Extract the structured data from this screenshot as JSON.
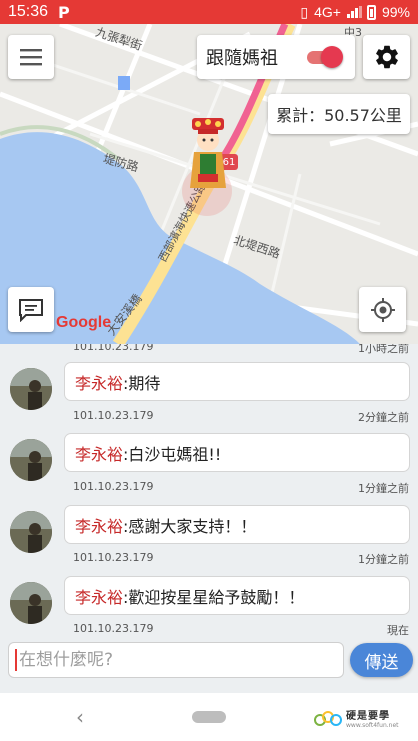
{
  "status_bar": {
    "time": "15:36",
    "app_icon": "P",
    "network": "4G+",
    "battery": "99%",
    "color": "#e53935"
  },
  "map": {
    "follow_label": "跟隨媽祖",
    "follow_enabled": true,
    "distance_text": "累計：50.57公里",
    "roads": [
      "九張犁街",
      "堤防路",
      "西部濱海快速公路",
      "北堤西路",
      "大安溪橋"
    ],
    "route_shield": "61",
    "corner_label": "中3",
    "google_logo": "Google"
  },
  "chat": {
    "top_meta": {
      "ip": "101.10.23.179",
      "time": "1小時之前"
    },
    "messages": [
      {
        "name": "李永裕",
        "text": ":期待",
        "ip": "101.10.23.179",
        "time": "2分鐘之前"
      },
      {
        "name": "李永裕",
        "text": ":白沙屯媽祖!!",
        "ip": "101.10.23.179",
        "time": "1分鐘之前"
      },
      {
        "name": "李永裕",
        "text": ":感謝大家支持！！",
        "ip": "101.10.23.179",
        "time": "1分鐘之前"
      },
      {
        "name": "李永裕",
        "text": ":歡迎按星星給予鼓勵！！",
        "ip": "101.10.23.179",
        "time": "現在"
      }
    ]
  },
  "input": {
    "placeholder": "在想什麼呢?",
    "value": "",
    "send_label": "傳送",
    "send_color": "#4a86d8"
  },
  "nav": {
    "brand_title": "硬是要學",
    "brand_url": "www.soft4fun.net"
  }
}
